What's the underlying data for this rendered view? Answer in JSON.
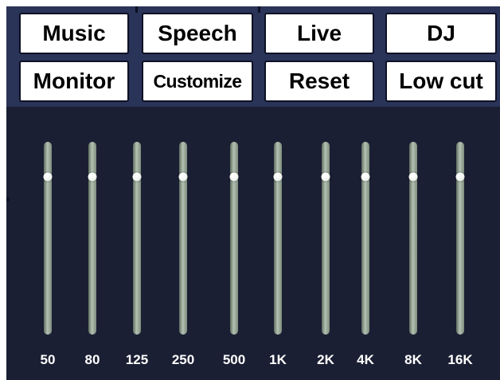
{
  "presets": {
    "row1": [
      "Music",
      "Speech",
      "Live",
      "DJ"
    ],
    "row2": [
      "Monitor",
      "Customize",
      "Reset",
      "Low cut"
    ]
  },
  "equalizer": {
    "bands": [
      {
        "label": "50",
        "level": 0.82
      },
      {
        "label": "80",
        "level": 0.82
      },
      {
        "label": "125",
        "level": 0.82
      },
      {
        "label": "250",
        "level": 0.82
      },
      {
        "label": "500",
        "level": 0.82
      },
      {
        "label": "1K",
        "level": 0.82
      },
      {
        "label": "2K",
        "level": 0.82
      },
      {
        "label": "4K",
        "level": 0.82
      },
      {
        "label": "8K",
        "level": 0.82
      },
      {
        "label": "16K",
        "level": 0.82
      }
    ]
  },
  "colors": {
    "panel_background": "#2a3358",
    "eq_background": "#1b1f33",
    "button_background": "#ffffff",
    "label_text": "#ffffff"
  }
}
